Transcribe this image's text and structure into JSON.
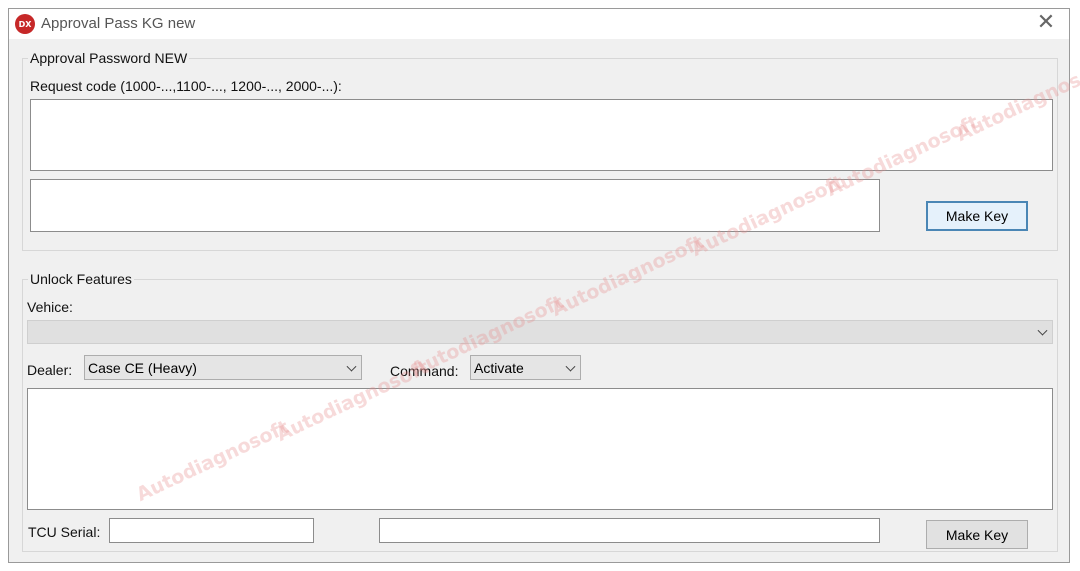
{
  "window": {
    "title": "Approval Pass KG new",
    "app_icon": "DX",
    "close_glyph": "✕"
  },
  "approval_group": {
    "label": "Approval Password NEW",
    "request_label": "Request code (1000-...,1100-..., 1200-..., 2000-...):",
    "request_value": "",
    "key_value": "",
    "make_key_label": "Make Key"
  },
  "unlock_group": {
    "label": "Unlock Features",
    "vehicle_label": "Vehice:",
    "vehicle_value": "",
    "dealer_label": "Dealer:",
    "dealer_value": "Case CE (Heavy)",
    "command_label": "Command:",
    "command_value": "Activate",
    "output_value": "",
    "tcu_label": "TCU Serial:",
    "tcu_value": "",
    "second_value": "",
    "make_key_label": "Make Key"
  },
  "watermark_text": "Autodiagnosoft",
  "colors": {
    "accent": "#4a86b5",
    "icon_red": "#c62828"
  }
}
